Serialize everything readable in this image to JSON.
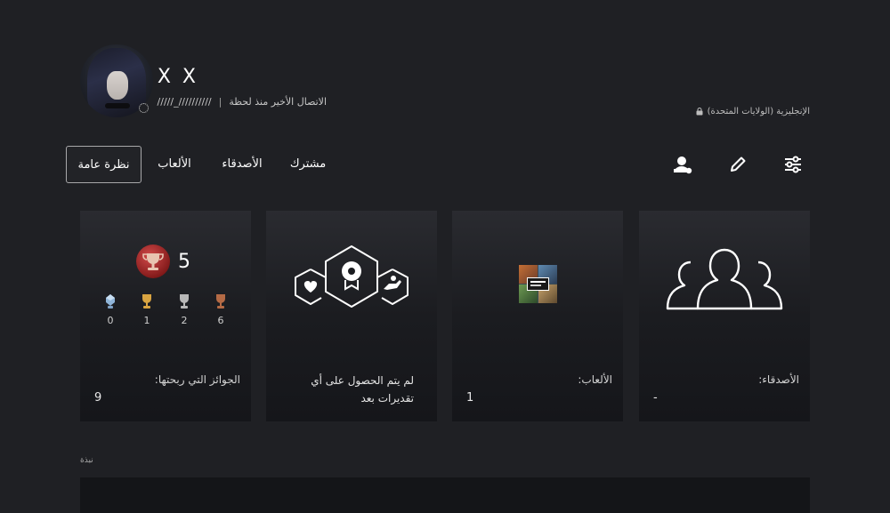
{
  "profile": {
    "name": "X X",
    "last_online": "الاتصال الأخير منذ لحظة",
    "separator": "|",
    "handle": "/////_//////////",
    "language": "الإنجليزية (الولايات المتحدة)"
  },
  "tabs": [
    {
      "label": "نظرة عامة",
      "selected": true
    },
    {
      "label": "الألعاب",
      "selected": false
    },
    {
      "label": "الأصدقاء",
      "selected": false
    },
    {
      "label": "مشترك",
      "selected": false
    }
  ],
  "tools": [
    "settings-sliders-icon",
    "edit-pencil-icon",
    "add-friend-icon"
  ],
  "cards": {
    "trophies": {
      "level": "5",
      "label": "الجوائز التي ربحتها:",
      "total": "9",
      "counts": {
        "platinum": "0",
        "gold": "1",
        "silver": "2",
        "bronze": "6"
      }
    },
    "recognition": {
      "text": "لم يتم الحصول على أي تقديرات بعد"
    },
    "games": {
      "label": "الألعاب:",
      "value": "1",
      "thumbnail": "gta-v-cover"
    },
    "friends": {
      "label": "الأصدقاء:",
      "value": "-"
    }
  },
  "bio": {
    "label": "نبذة"
  },
  "colors": {
    "background": "#1f2024",
    "card": "#222328",
    "trophy_level": "#b02a2a",
    "platinum": "#8fb4d8",
    "gold": "#d9a441",
    "silver": "#b8b8b8",
    "bronze": "#b46a45"
  }
}
